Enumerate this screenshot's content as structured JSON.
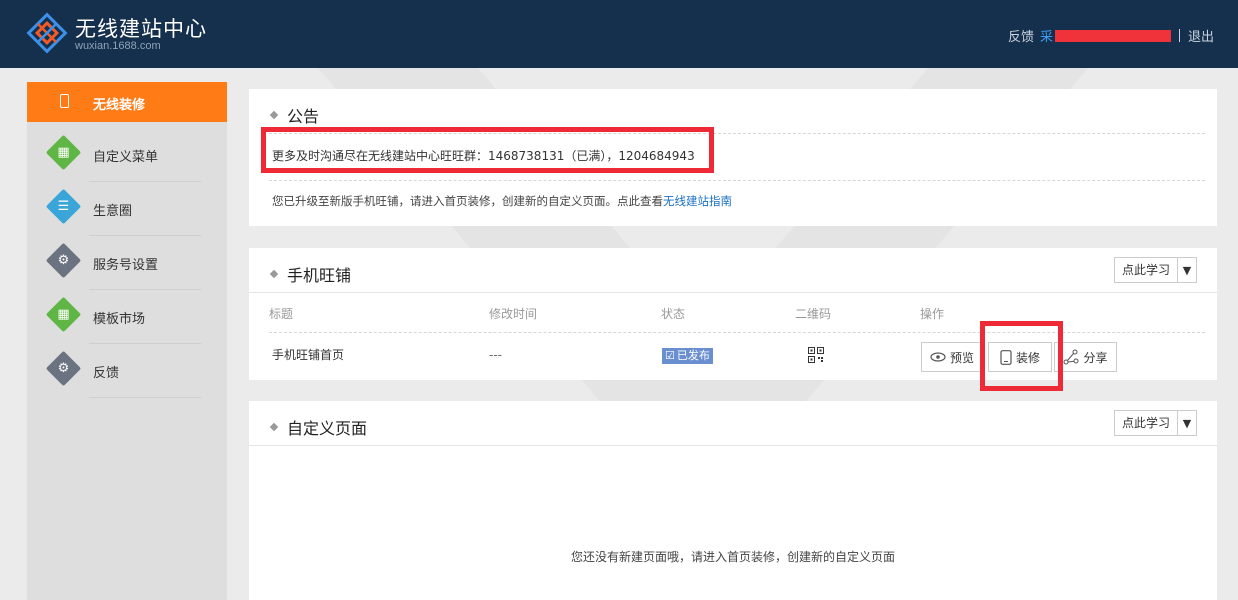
{
  "header": {
    "logo_title": "无线建站中心",
    "logo_sub": "wuxian.1688.com",
    "feedback": "反馈",
    "user_prefix": "采",
    "logout": "退出",
    "colors": {
      "bg": "#15304d",
      "user": "#3f9cf0",
      "redact": "#f0323a"
    }
  },
  "sidebar": {
    "active": {
      "label": "无线装修",
      "icon": "phone-icon",
      "color": "#ff7b16"
    },
    "items": [
      {
        "label": "自定义菜单",
        "icon": "grid-icon",
        "color": "#5fb644"
      },
      {
        "label": "生意圈",
        "icon": "document-icon",
        "color": "#3aa5d9"
      },
      {
        "label": "服务号设置",
        "icon": "gear-icon",
        "color": "#6b7280"
      },
      {
        "label": "模板市场",
        "icon": "grid-icon",
        "color": "#5fb644"
      },
      {
        "label": "反馈",
        "icon": "gear-icon",
        "color": "#6b7280"
      }
    ]
  },
  "notice": {
    "title": "公告",
    "line1": "更多及时沟通尽在无线建站中心旺旺群：1468738131（已满），1204684943",
    "line2": "您已升级至新版手机旺铺，请进入首页装修，创建新的自定义页面。点此查看",
    "guide_link": "无线建站指南"
  },
  "mobile_shop": {
    "title": "手机旺铺",
    "learn": "点此学习",
    "columns": [
      "标题",
      "修改时间",
      "状态",
      "二维码",
      "操作"
    ],
    "row": {
      "title": "手机旺铺首页",
      "modified": "---",
      "status": "已发布",
      "qr_icon": "qrcode-icon"
    },
    "actions": {
      "preview": "预览",
      "decorate": "装修",
      "share": "分享"
    }
  },
  "custom_pages": {
    "title": "自定义页面",
    "learn": "点此学习",
    "empty_text": "您还没有新建页面哦，请进入首页装修，创建新的自定义页面"
  }
}
